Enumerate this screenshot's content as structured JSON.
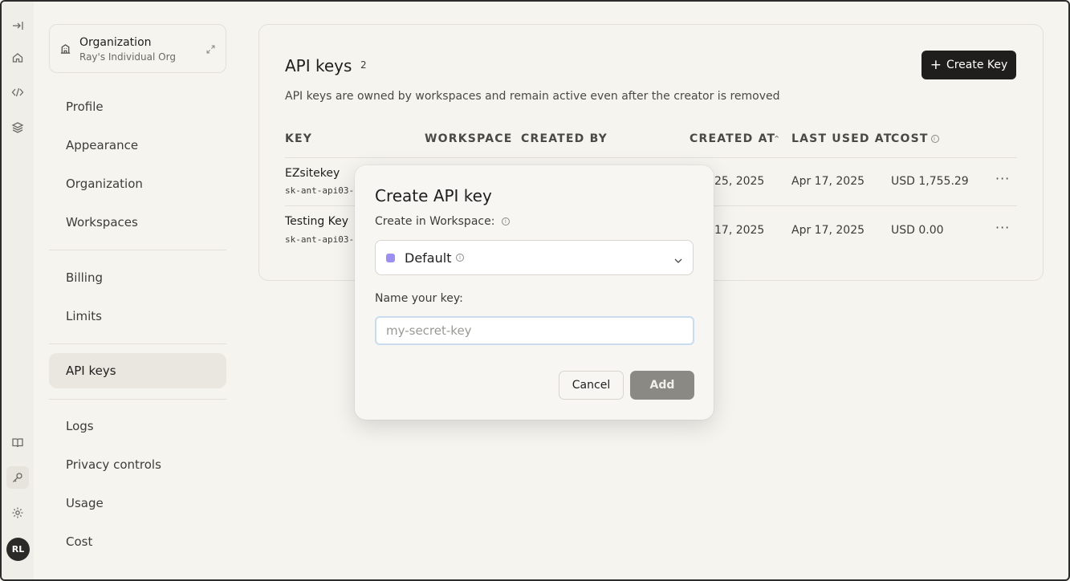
{
  "rail": {
    "avatar_initials": "RL"
  },
  "org": {
    "title": "Organization",
    "subtitle": "Ray's Individual Org"
  },
  "sidebar": {
    "items": [
      {
        "label": "Profile"
      },
      {
        "label": "Appearance"
      },
      {
        "label": "Organization"
      },
      {
        "label": "Workspaces"
      },
      {
        "label": "Billing"
      },
      {
        "label": "Limits"
      },
      {
        "label": "API keys"
      },
      {
        "label": "Logs"
      },
      {
        "label": "Privacy controls"
      },
      {
        "label": "Usage"
      },
      {
        "label": "Cost"
      }
    ],
    "active": "API keys"
  },
  "api_keys": {
    "title": "API keys",
    "count": "2",
    "create_label": "Create Key",
    "description": "API keys are owned by workspaces and remain active even after the creator is removed",
    "columns": {
      "key": "KEY",
      "workspace": "WORKSPACE",
      "created_by": "CREATED BY",
      "created_at": "CREATED AT",
      "last_used_at": "LAST USED AT",
      "cost": "COST"
    },
    "rows": [
      {
        "name": "EZsitekey",
        "key_prefix": "sk-ant-api03-",
        "created_at": "25, 2025",
        "last_used": "Apr 17, 2025",
        "cost": "USD 1,755.29"
      },
      {
        "name": "Testing Key",
        "key_prefix": "sk-ant-api03-",
        "created_at": "17, 2025",
        "last_used": "Apr 17, 2025",
        "cost": "USD 0.00"
      }
    ]
  },
  "modal": {
    "title": "Create API key",
    "workspace_label": "Create in Workspace:",
    "workspace_value": "Default",
    "workspace_color": "#9b8ff0",
    "name_label": "Name your key:",
    "name_placeholder": "my-secret-key",
    "name_value": "",
    "cancel_label": "Cancel",
    "add_label": "Add"
  },
  "colors": {
    "background": "#f5f4ef",
    "primary_button": "#1f1e1d",
    "disabled_button": "#8a8984",
    "focus_ring": "#c9dcee"
  }
}
